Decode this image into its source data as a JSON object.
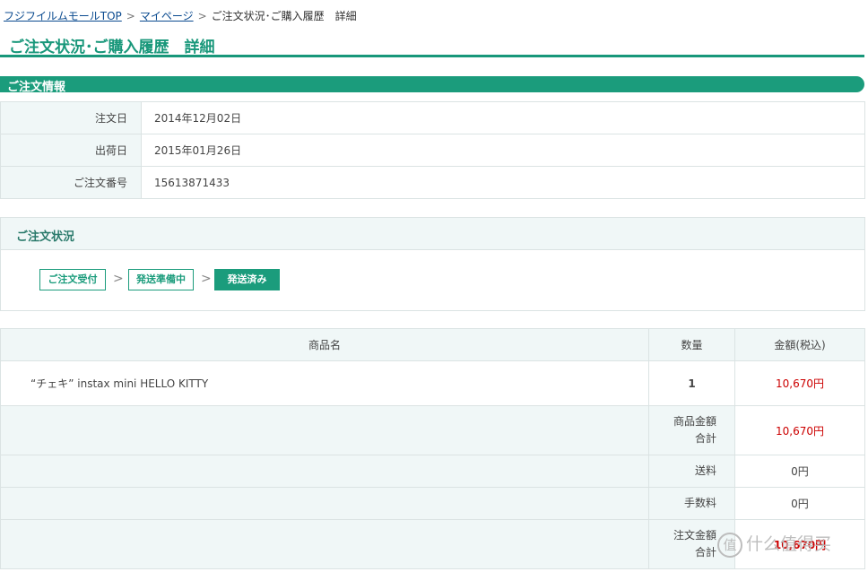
{
  "breadcrumb": {
    "home": "フジフイルムモールTOP",
    "mypage": "マイページ",
    "current": "ご注文状況･ご購入履歴　詳細",
    "separator": ">"
  },
  "page_title": "ご注文状況･ご購入履歴　詳細",
  "order_info": {
    "heading": "ご注文情報",
    "rows": [
      {
        "label": "注文日",
        "value": "2014年12月02日"
      },
      {
        "label": "出荷日",
        "value": "2015年01月26日"
      },
      {
        "label": "ご注文番号",
        "value": "15613871433"
      }
    ]
  },
  "order_status": {
    "heading": "ご注文状況",
    "steps": [
      {
        "label": "ご注文受付",
        "state": "done"
      },
      {
        "label": "発送準備中",
        "state": "done"
      },
      {
        "label": "発送済み",
        "state": "current"
      }
    ],
    "arrow": ">"
  },
  "items_table": {
    "headers": {
      "name": "商品名",
      "qty": "数量",
      "price": "金額(税込)"
    },
    "items": [
      {
        "name": "“チェキ” instax mini HELLO KITTY",
        "qty": "1",
        "price": "10,670円"
      }
    ],
    "summary": [
      {
        "label_line1": "商品金額",
        "label_line2": "合計",
        "value": "10,670円"
      },
      {
        "label_line1": "送料",
        "label_line2": "",
        "value": "0円"
      },
      {
        "label_line1": "手数料",
        "label_line2": "",
        "value": "0円"
      },
      {
        "label_line1": "注文金額",
        "label_line2": "合計",
        "value": "10,670円"
      }
    ]
  },
  "watermark": {
    "logo_char": "值",
    "text": "什么值得买"
  },
  "colors": {
    "accent": "#1b9c7c",
    "price_red": "#cc0000",
    "row_bg": "#f0f7f7"
  }
}
